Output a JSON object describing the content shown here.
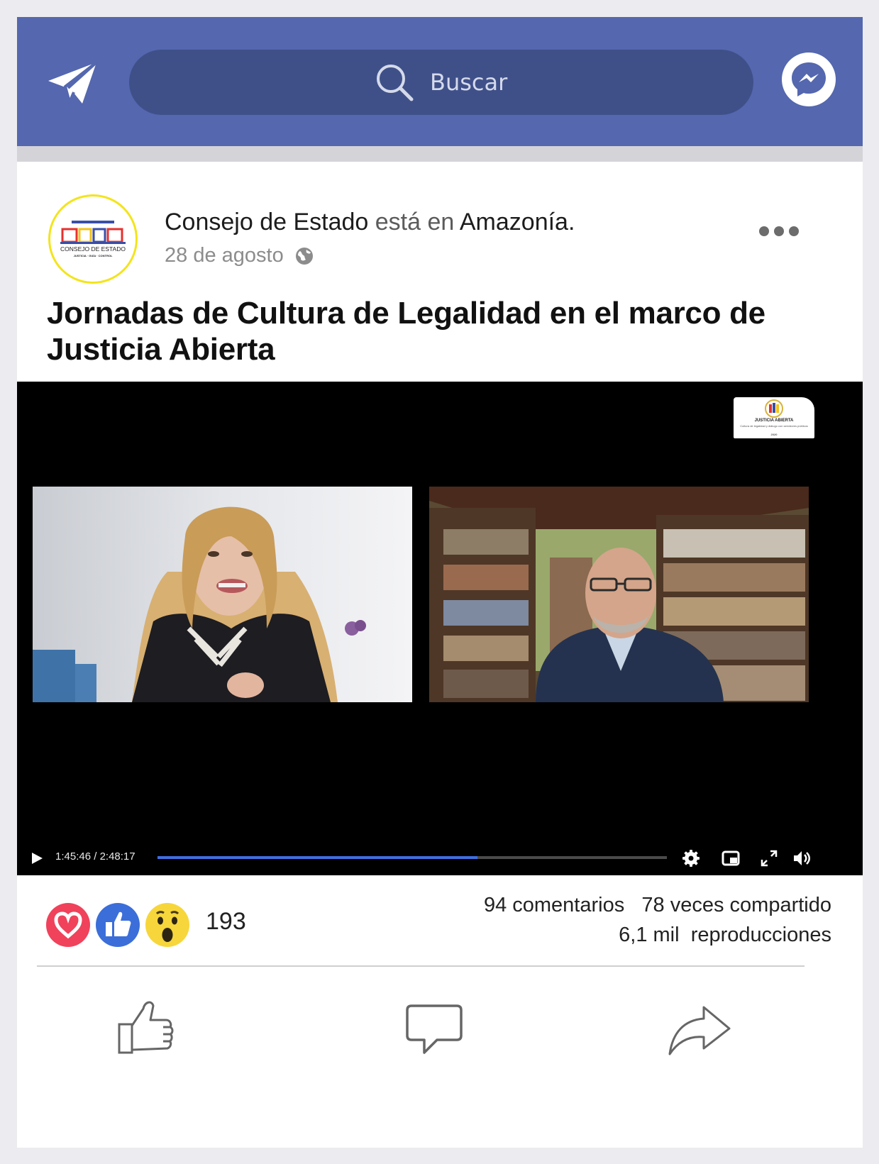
{
  "topbar": {
    "search_placeholder": "Buscar",
    "colors": {
      "bar": "#5467af",
      "search_bg": "#3f5089"
    },
    "icons": [
      "paper-plane-icon",
      "search-icon",
      "messenger-icon"
    ]
  },
  "post": {
    "author": "Consejo de Estado",
    "verb": "está en",
    "location": "Amazonía.",
    "date": "28 de agosto",
    "privacy_icon": "globe-icon",
    "title": "Jornadas de Cultura de Legalidad en el marco de Justicia Abierta",
    "avatar_text": {
      "org": "CONSEJO DE ESTADO",
      "motto": "JUSTICIA · GUÍA · CONTROL"
    }
  },
  "video": {
    "current_time": "1:45:46",
    "separator": " / ",
    "duration": "2:48:17",
    "progress": 0.628,
    "overlay_logo": {
      "title": "JUSTICIA ABIERTA",
      "subtitle": "Cultura de legalidad y diálogo con servidores públicos",
      "year": "2020"
    },
    "controls": [
      "play-icon",
      "settings-gear-icon",
      "miniplayer-icon",
      "fullscreen-icon",
      "volume-icon"
    ],
    "accent": "#3f6fe0"
  },
  "engagement": {
    "reactions": [
      "love-reaction-icon",
      "like-reaction-icon",
      "wow-reaction-icon"
    ],
    "reaction_count": "193",
    "comments": "94 comentarios",
    "shares": "78 veces compartido",
    "views_count": "6,1 mil",
    "views_label": "reproducciones"
  },
  "actions": [
    "like-icon",
    "comment-icon",
    "share-icon"
  ]
}
